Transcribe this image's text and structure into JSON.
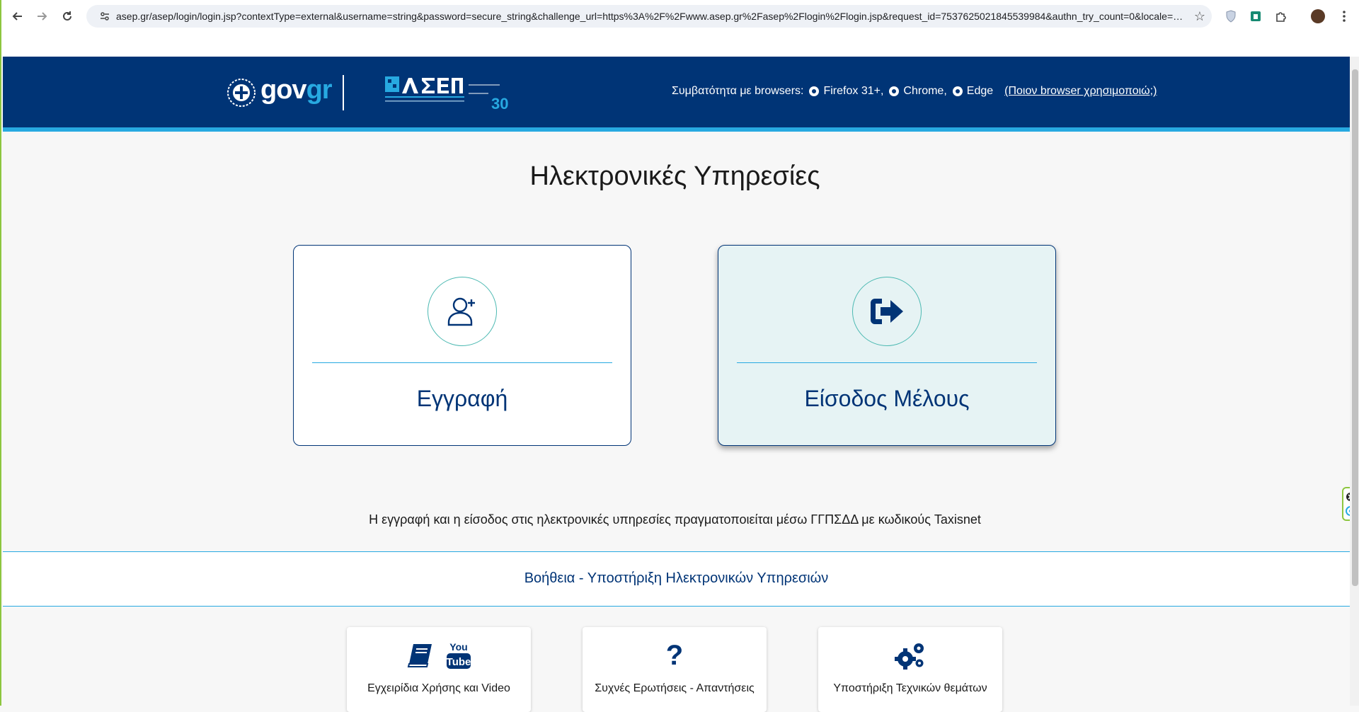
{
  "browser": {
    "url": "asep.gr/asep/login/login.jsp?contextType=external&username=string&password=secure_string&challenge_url=https%3A%2F%2Fwww.asep.gr%2Fasep%2Flogin%2Flogin.jsp&request_id=7537625021845539984&authn_try_count=0&locale=el_..."
  },
  "header": {
    "gov_prefix": "gov",
    "gov_suffix": "gr",
    "compat_label": "Συμβατότητα με browsers:",
    "browsers": [
      "Firefox 31+,",
      "Chrome,",
      "Edge"
    ],
    "which_browser_link": "(Ποιον browser χρησιμοποιώ;)"
  },
  "main": {
    "title": "Ηλεκτρονικές Υπηρεσίες",
    "register_label": "Εγγραφή",
    "login_label": "Είσοδος Μέλους",
    "info": "Η εγγραφή και η είσοδος στις ηλεκτρονικές υπηρεσίες πραγματοποιείται μέσω ΓΓΠΣΔΔ με κωδικούς Taxisnet"
  },
  "help": {
    "title": "Βοήθεια - Υποστήριξη Ηλεκτρονικών Υπηρεσιών",
    "cards": [
      {
        "label": "Εγχειρίδια Χρήσης και Video",
        "youtube_top": "You",
        "youtube_bottom": "Tube"
      },
      {
        "label": "Συχνές Ερωτήσεις - Απαντήσεις",
        "icon": "?"
      },
      {
        "label": "Υποστήριξη Τεχνικών θεμάτων"
      }
    ]
  },
  "colors": {
    "header_bg": "#003476",
    "accent": "#27a9e1",
    "teal": "#4cb9b2"
  }
}
